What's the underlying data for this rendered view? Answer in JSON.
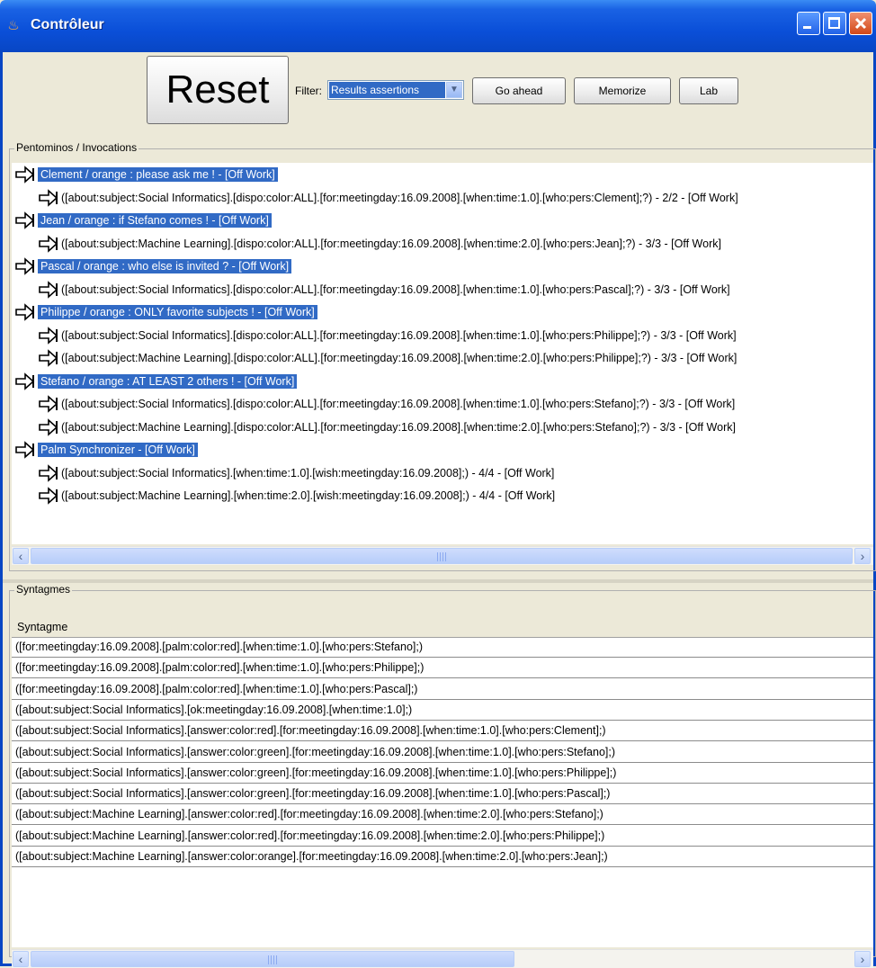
{
  "window": {
    "title": "Contrôleur"
  },
  "toolbar": {
    "reset_label": "Reset",
    "filter_label": "Filter:",
    "filter_value": "Results assertions",
    "go_ahead_label": "Go ahead",
    "memorize_label": "Memorize",
    "lab_label": "Lab"
  },
  "pentominos": {
    "title": "Pentominos / Invocations",
    "nodes": [
      {
        "label": "Clement / orange : please ask me ! - [Off Work]",
        "children": [
          "([about:subject:Social Informatics].[dispo:color:ALL].[for:meetingday:16.09.2008].[when:time:1.0].[who:pers:Clement];?) - 2/2 - [Off Work]"
        ]
      },
      {
        "label": "Jean / orange : if Stefano comes ! - [Off Work]",
        "children": [
          "([about:subject:Machine Learning].[dispo:color:ALL].[for:meetingday:16.09.2008].[when:time:2.0].[who:pers:Jean];?) - 3/3 - [Off Work]"
        ]
      },
      {
        "label": "Pascal / orange : who else is invited ? - [Off Work]",
        "children": [
          "([about:subject:Social Informatics].[dispo:color:ALL].[for:meetingday:16.09.2008].[when:time:1.0].[who:pers:Pascal];?) - 3/3 - [Off Work]"
        ]
      },
      {
        "label": "Philippe / orange : ONLY favorite subjects ! - [Off Work]",
        "children": [
          "([about:subject:Social Informatics].[dispo:color:ALL].[for:meetingday:16.09.2008].[when:time:1.0].[who:pers:Philippe];?) - 3/3 - [Off Work]",
          "([about:subject:Machine Learning].[dispo:color:ALL].[for:meetingday:16.09.2008].[when:time:2.0].[who:pers:Philippe];?) - 3/3 - [Off Work]"
        ]
      },
      {
        "label": "Stefano / orange : AT LEAST 2 others ! - [Off Work]",
        "children": [
          "([about:subject:Social Informatics].[dispo:color:ALL].[for:meetingday:16.09.2008].[when:time:1.0].[who:pers:Stefano];?) - 3/3 - [Off Work]",
          "([about:subject:Machine Learning].[dispo:color:ALL].[for:meetingday:16.09.2008].[when:time:2.0].[who:pers:Stefano];?) - 3/3 - [Off Work]"
        ]
      },
      {
        "label": "Palm Synchronizer - [Off Work]",
        "children": [
          "([about:subject:Social Informatics].[when:time:1.0].[wish:meetingday:16.09.2008];) - 4/4 - [Off Work]",
          "([about:subject:Machine Learning].[when:time:2.0].[wish:meetingday:16.09.2008];) - 4/4 - [Off Work]"
        ]
      }
    ]
  },
  "syntagmes": {
    "title": "Syntagmes",
    "column_header": "Syntagme",
    "rows": [
      "([for:meetingday:16.09.2008].[palm:color:red].[when:time:1.0].[who:pers:Stefano];)",
      "([for:meetingday:16.09.2008].[palm:color:red].[when:time:1.0].[who:pers:Philippe];)",
      "([for:meetingday:16.09.2008].[palm:color:red].[when:time:1.0].[who:pers:Pascal];)",
      "([about:subject:Social Informatics].[ok:meetingday:16.09.2008].[when:time:1.0];)",
      "([about:subject:Social Informatics].[answer:color:red].[for:meetingday:16.09.2008].[when:time:1.0].[who:pers:Clement];)",
      "([about:subject:Social Informatics].[answer:color:green].[for:meetingday:16.09.2008].[when:time:1.0].[who:pers:Stefano];)",
      "([about:subject:Social Informatics].[answer:color:green].[for:meetingday:16.09.2008].[when:time:1.0].[who:pers:Philippe];)",
      "([about:subject:Social Informatics].[answer:color:green].[for:meetingday:16.09.2008].[when:time:1.0].[who:pers:Pascal];)",
      "([about:subject:Machine Learning].[answer:color:red].[for:meetingday:16.09.2008].[when:time:2.0].[who:pers:Stefano];)",
      "([about:subject:Machine Learning].[answer:color:red].[for:meetingday:16.09.2008].[when:time:2.0].[who:pers:Philippe];)",
      "([about:subject:Machine Learning].[answer:color:orange].[for:meetingday:16.09.2008].[when:time:2.0].[who:pers:Jean];)"
    ]
  },
  "colors": {
    "selection": "#316ac5",
    "titlebar": "#0a4fd8",
    "window_bg": "#ece9d8"
  }
}
